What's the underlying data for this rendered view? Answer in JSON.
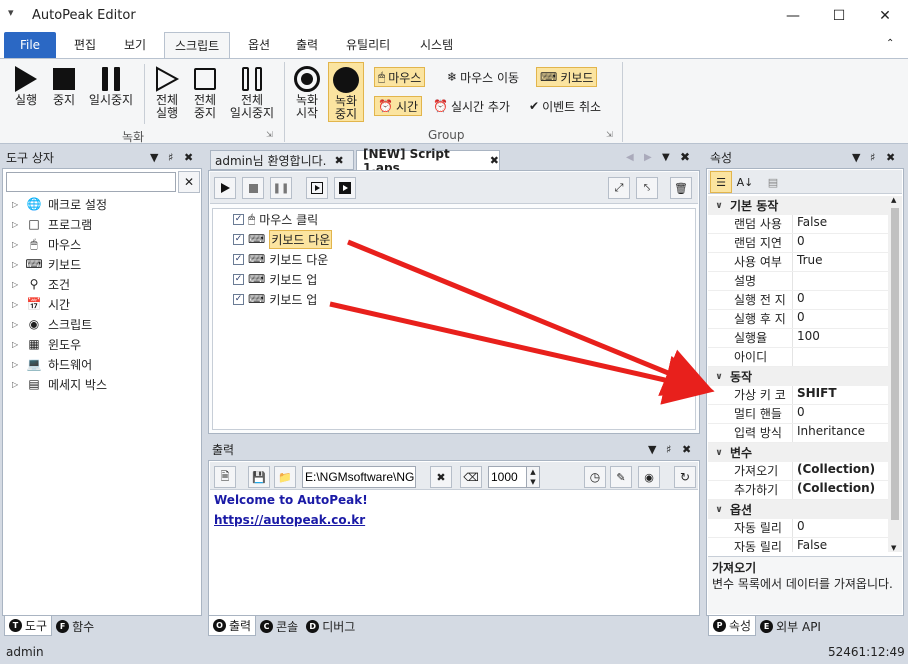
{
  "window": {
    "title": "AutoPeak Editor",
    "menu_glyph": "▾"
  },
  "menu": {
    "file": "File",
    "tabs": [
      "편집",
      "보기",
      "스크립트",
      "옵션",
      "출력",
      "유틸리티",
      "시스템"
    ],
    "active": "스크립트"
  },
  "ribbon": {
    "record_group": {
      "label": "녹화",
      "buttons": [
        {
          "l1": "실행",
          "l2": ""
        },
        {
          "l1": "중지",
          "l2": ""
        },
        {
          "l1": "일시중지",
          "l2": ""
        },
        {
          "l1": "전체",
          "l2": "실행"
        },
        {
          "l1": "전체",
          "l2": "중지"
        },
        {
          "l1": "전체",
          "l2": "일시중지"
        }
      ]
    },
    "group_group": {
      "label": "Group",
      "rec_start": {
        "l1": "녹화",
        "l2": "시작"
      },
      "rec_stop": {
        "l1": "녹화",
        "l2": "중지"
      },
      "chips": {
        "mouse": "마우스",
        "mouse_move": "마우스 이동",
        "keyboard": "키보드",
        "time": "시간",
        "realtime_add": "실시간 추가",
        "event_cancel": "이벤트 취소"
      }
    }
  },
  "toolbox": {
    "title": "도구 상자",
    "search_value": "",
    "items": [
      "매크로 설정",
      "프로그램",
      "마우스",
      "키보드",
      "조건",
      "시간",
      "스크립트",
      "윈도우",
      "하드웨어",
      "메세지 박스"
    ],
    "tabs": [
      {
        "letter": "T",
        "label": "도구"
      },
      {
        "letter": "F",
        "label": "함수"
      }
    ]
  },
  "editor": {
    "tabs": [
      "admin님 환영합니다.",
      "[NEW] Script 1.aps"
    ],
    "steps": [
      {
        "label": "마우스 클릭",
        "checked": true,
        "indent": 0,
        "icon": "mouse-click-icon"
      },
      {
        "label": "키보드 다운",
        "checked": true,
        "indent": 1,
        "icon": "keyboard-icon",
        "highlight": true
      },
      {
        "label": "키보드 다운",
        "checked": true,
        "indent": 0,
        "icon": "keyboard-icon"
      },
      {
        "label": "키보드 업",
        "checked": true,
        "indent": 0,
        "icon": "keyboard-up-icon"
      },
      {
        "label": "키보드 업",
        "checked": true,
        "indent": 0,
        "icon": "keyboard-up-icon"
      }
    ]
  },
  "output": {
    "title": "출력",
    "path": "E:\\NGMsoftware\\NG",
    "delay": "1000",
    "lines": [
      "Welcome to AutoPeak!",
      "https://autopeak.co.kr"
    ],
    "tabs": [
      {
        "letter": "O",
        "label": "출력"
      },
      {
        "letter": "C",
        "label": "콘솔"
      },
      {
        "letter": "D",
        "label": "디버그"
      }
    ]
  },
  "properties": {
    "title": "속성",
    "categories": [
      {
        "name": "기본 동작",
        "rows": [
          [
            "랜덤 사용",
            "False"
          ],
          [
            "랜덤 지연",
            "0"
          ],
          [
            "사용 여부",
            "True"
          ],
          [
            "설명",
            ""
          ],
          [
            "실행 전 지",
            "0"
          ],
          [
            "실행 후 지",
            "0"
          ],
          [
            "실행율",
            "100"
          ],
          [
            "아이디",
            ""
          ]
        ]
      },
      {
        "name": "동작",
        "rows": [
          [
            "가상 키 코",
            "SHIFT"
          ],
          [
            "멀티 핸들",
            "0"
          ],
          [
            "입력 방식",
            "Inheritance"
          ]
        ]
      },
      {
        "name": "변수",
        "rows": [
          [
            "가져오기",
            "(Collection)"
          ],
          [
            "추가하기",
            "(Collection)"
          ]
        ]
      },
      {
        "name": "옵션",
        "rows": [
          [
            "자동 릴리",
            "0"
          ],
          [
            "자동 릴리",
            "False"
          ]
        ]
      }
    ],
    "desc_title": "가져오기",
    "desc_text": "변수 목록에서 데이터를 가져옵니다.",
    "tabs": [
      {
        "letter": "P",
        "label": "속성"
      },
      {
        "letter": "E",
        "label": "외부 API"
      }
    ]
  },
  "status": {
    "user": "admin",
    "time": "52461:12:49"
  }
}
